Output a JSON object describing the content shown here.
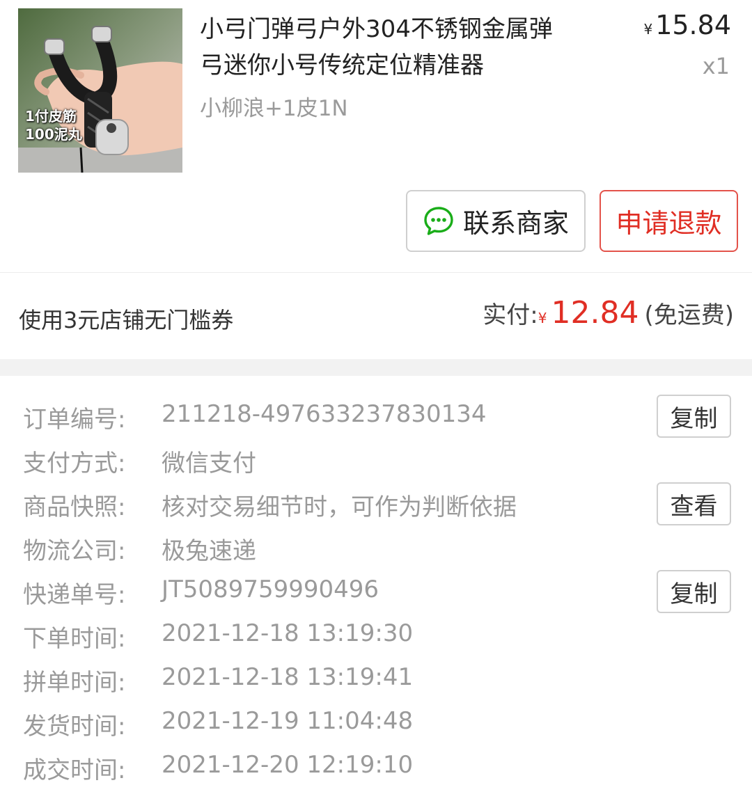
{
  "product": {
    "thumbnail_caption": [
      "1付皮筋",
      "100泥丸"
    ],
    "title_lines": [
      "小弓门弹弓户外304不锈钢金属弹",
      "弓迷你小号传统定位精准器"
    ],
    "price_symbol": "¥",
    "price": "15.84",
    "quantity": "x1",
    "sku": "小柳浪+1皮1N",
    "contact_button": "联系商家",
    "refund_button": "申请退款"
  },
  "payment": {
    "coupon": "使用3元店铺无门槛券",
    "paid_label": "实付:",
    "currency": "¥",
    "paid_amount": "12.84",
    "shipping_note": "(免运费)"
  },
  "details": [
    {
      "label": "订单编号:",
      "value": "211218-497633237830134",
      "action": "复制"
    },
    {
      "label": "支付方式:",
      "value": "微信支付",
      "action": ""
    },
    {
      "label": "商品快照:",
      "value": "核对交易细节时，可作为判断依据",
      "action": "查看"
    },
    {
      "label": "物流公司:",
      "value": "极兔速递",
      "action": ""
    },
    {
      "label": "快递单号:",
      "value": "JT5089759990496",
      "action": "复制"
    },
    {
      "label": "下单时间:",
      "value": "2021-12-18 13:19:30",
      "action": ""
    },
    {
      "label": "拼单时间:",
      "value": "2021-12-18 13:19:41",
      "action": ""
    },
    {
      "label": "发货时间:",
      "value": "2021-12-19 11:04:48",
      "action": ""
    },
    {
      "label": "成交时间:",
      "value": "2021-12-20 12:19:10",
      "action": ""
    }
  ],
  "colors": {
    "accent_red": "#e02e24",
    "wechat_green": "#1aad19",
    "muted_text": "#9a9a9a"
  }
}
